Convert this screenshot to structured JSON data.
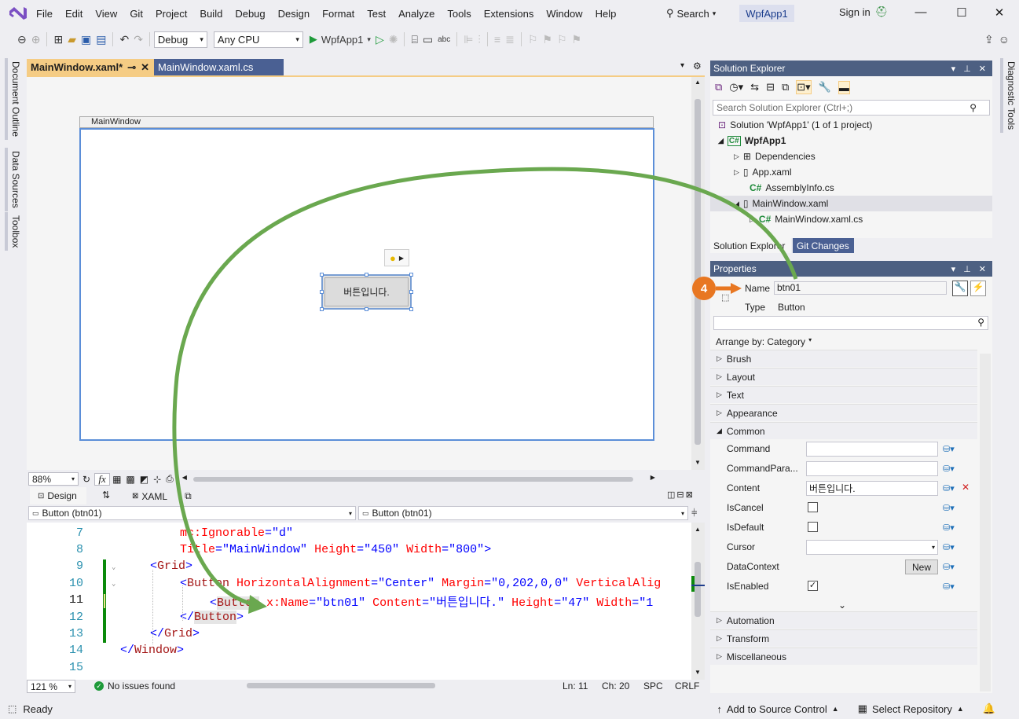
{
  "menubar": {
    "items": [
      "File",
      "Edit",
      "View",
      "Git",
      "Project",
      "Build",
      "Debug",
      "Design",
      "Format",
      "Test",
      "Analyze",
      "Tools",
      "Extensions",
      "Window",
      "Help"
    ],
    "search_label": "Search",
    "solution_name": "WpfApp1",
    "signin_label": "Sign in"
  },
  "toolbar": {
    "config": "Debug",
    "platform": "Any CPU",
    "run_label": "WpfApp1"
  },
  "left_rail": [
    "Document Outline",
    "Data Sources",
    "Toolbox"
  ],
  "right_rail": [
    "Diagnostic Tools"
  ],
  "doc_tabs": [
    {
      "label": "MainWindow.xaml*",
      "active": true
    },
    {
      "label": "MainWindow.xaml.cs",
      "active": false
    }
  ],
  "designer": {
    "window_title": "MainWindow",
    "button_content": "버튼입니다.",
    "zoom": "88%",
    "fx_label": "fx"
  },
  "split": {
    "design_label": "Design",
    "swap_label": "⇅",
    "xaml_label": "XAML"
  },
  "nav": {
    "left": "Button (btn01)",
    "right": "Button (btn01)"
  },
  "editor": {
    "lines": [
      {
        "num": "7",
        "text": "mc:Ignorable=\"d\""
      },
      {
        "num": "8",
        "text": "Title=\"MainWindow\" Height=\"450\" Width=\"800\">"
      },
      {
        "num": "9",
        "text": "<Grid>"
      },
      {
        "num": "10",
        "text": "<Button HorizontalAlignment=\"Center\" Margin=\"0,202,0,0\" VerticalAlig"
      },
      {
        "num": "11",
        "text": "<Button x:Name=\"btn01\" Content=\"버튼입니다.\" Height=\"47\" Width=\"1"
      },
      {
        "num": "12",
        "text": "</Button>"
      },
      {
        "num": "13",
        "text": "</Grid>"
      },
      {
        "num": "14",
        "text": "</Window>"
      },
      {
        "num": "15",
        "text": ""
      }
    ],
    "zoom": "121 %",
    "issues": "No issues found",
    "ln": "Ln: 11",
    "ch": "Ch: 20",
    "spc": "SPC",
    "crlf": "CRLF"
  },
  "solution_explorer": {
    "title": "Solution Explorer",
    "search_placeholder": "Search Solution Explorer (Ctrl+;)",
    "items": [
      {
        "label": "Solution 'WpfApp1' (1 of 1 project)"
      },
      {
        "label": "WpfApp1"
      },
      {
        "label": "Dependencies"
      },
      {
        "label": "App.xaml"
      },
      {
        "label": "AssemblyInfo.cs"
      },
      {
        "label": "MainWindow.xaml"
      },
      {
        "label": "MainWindow.xaml.cs"
      }
    ],
    "tabs": [
      "Solution Explorer",
      "Git Changes"
    ]
  },
  "properties": {
    "title": "Properties",
    "name_label": "Name",
    "name_value": "btn01",
    "type_label": "Type",
    "type_value": "Button",
    "arrange_label": "Arrange by: Category",
    "categories_top": [
      "Brush",
      "Layout",
      "Text",
      "Appearance"
    ],
    "common_label": "Common",
    "common_rows": [
      {
        "label": "Command",
        "kind": "input",
        "value": ""
      },
      {
        "label": "CommandPara...",
        "kind": "input",
        "value": ""
      },
      {
        "label": "Content",
        "kind": "input",
        "value": "버튼입니다."
      },
      {
        "label": "IsCancel",
        "kind": "check",
        "value": ""
      },
      {
        "label": "IsDefault",
        "kind": "check",
        "value": ""
      },
      {
        "label": "Cursor",
        "kind": "select",
        "value": ""
      },
      {
        "label": "DataContext",
        "kind": "button",
        "value": "New"
      },
      {
        "label": "IsEnabled",
        "kind": "check",
        "value": "✓"
      }
    ],
    "categories_bottom": [
      "Automation",
      "Transform",
      "Miscellaneous"
    ]
  },
  "callout_number": "4",
  "statusbar": {
    "ready": "Ready",
    "source_control": "Add to Source Control",
    "repository": "Select Repository"
  },
  "colors": {
    "accent": "#68217a",
    "tab_active": "#f5cc84",
    "callout": "#e87722",
    "annotation_arrow": "#6aa84f"
  }
}
